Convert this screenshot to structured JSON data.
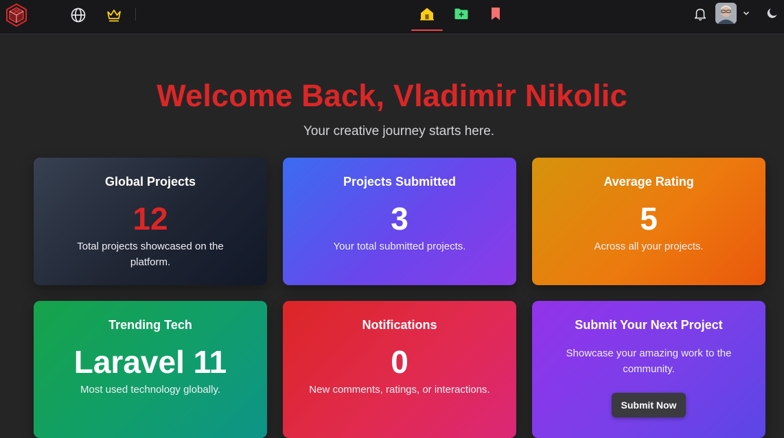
{
  "nav": {
    "icons": {
      "logo": "cube-hexagon-logo",
      "globe": "globe-icon",
      "crown": "crown-icon",
      "home": "home-icon",
      "folder_add": "folder-plus-icon",
      "bookmark": "bookmark-icon",
      "bell": "bell-icon",
      "chevron": "chevron-down-icon",
      "moon": "moon-icon"
    },
    "active_tab": "home"
  },
  "header": {
    "welcome": "Welcome Back, Vladimir Nikolic",
    "subtitle": "Your creative journey starts here."
  },
  "cards": [
    {
      "title": "Global Projects",
      "value": "12",
      "desc": "Total projects showcased on the platform."
    },
    {
      "title": "Projects Submitted",
      "value": "3",
      "desc": "Your total submitted projects."
    },
    {
      "title": "Average Rating",
      "value": "5",
      "desc": "Across all your projects."
    },
    {
      "title": "Trending Tech",
      "value": "Laravel 11",
      "desc": "Most used technology globally."
    },
    {
      "title": "Notifications",
      "value": "0",
      "desc": "New comments, ratings, or interactions."
    },
    {
      "title": "Submit Your Next Project",
      "desc": "Showcase your amazing work to the community.",
      "button": "Submit Now"
    }
  ],
  "colors": {
    "accent": "#dc2626",
    "background": "#252526",
    "navbar": "#18181a"
  }
}
